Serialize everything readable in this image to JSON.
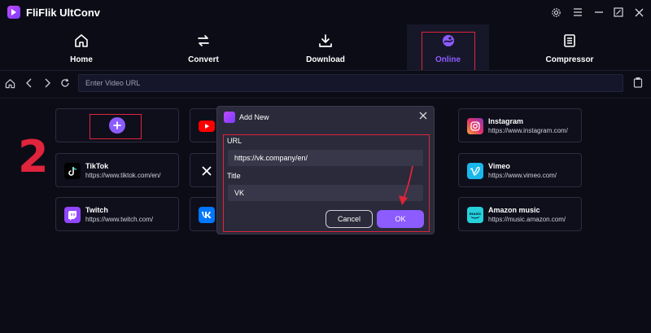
{
  "app": {
    "title": "FliFlik UltConv"
  },
  "window_controls": [
    {
      "name": "settings-icon"
    },
    {
      "name": "menu-icon"
    },
    {
      "name": "minimize-icon"
    },
    {
      "name": "close-icon"
    }
  ],
  "tabs": [
    {
      "label": "Home",
      "icon": "home-icon"
    },
    {
      "label": "Convert",
      "icon": "convert-icon"
    },
    {
      "label": "Download",
      "icon": "download-icon"
    },
    {
      "label": "Online",
      "icon": "online-icon",
      "active": true
    },
    {
      "label": "Compressor",
      "icon": "compressor-icon"
    }
  ],
  "toolbar": {
    "url_placeholder": "Enter Video URL"
  },
  "annotation": {
    "step": "2"
  },
  "sites": [
    {
      "name": "Instagram",
      "url": "https://www.instagram.com/",
      "icon": "instagram-icon"
    },
    {
      "name": "TikTok",
      "url": "https://www.tiktok.com/en/",
      "icon": "tiktok-icon"
    },
    {
      "name": "Vimeo",
      "url": "https://www.vimeo.com/",
      "icon": "vimeo-icon"
    },
    {
      "name": "Twitch",
      "url": "https://www.twitch.com/",
      "icon": "twitch-icon"
    },
    {
      "name": "Amazon music",
      "url": "https://music.amazon.com/",
      "icon": "amazon-music-icon"
    }
  ],
  "dialog": {
    "title": "Add New",
    "url_label": "URL",
    "url_value": "https://vk.company/en/",
    "title_label": "Title",
    "title_value": "VK",
    "cancel_label": "Cancel",
    "ok_label": "OK"
  },
  "colors": {
    "accent": "#8c5cff",
    "highlight": "#e0243b",
    "background": "#0c0c17"
  }
}
